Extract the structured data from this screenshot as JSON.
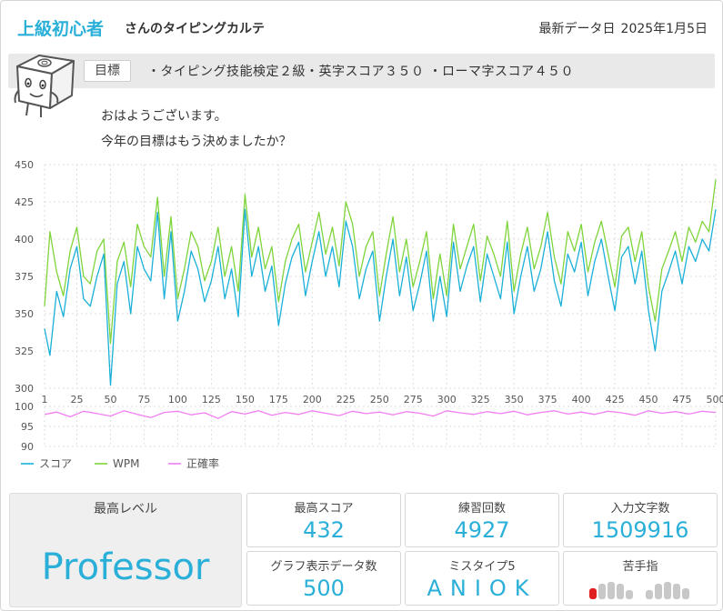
{
  "header": {
    "user_name": "上級初心者",
    "user_suffix": "さんのタイピングカルテ",
    "latest_label": "最新データ日",
    "latest_date": "2025年1月5日"
  },
  "goal": {
    "label": "目標",
    "text": "・タイピング技能検定２級・英字スコア３５０ ・ローマ字スコア４５０"
  },
  "greeting": {
    "line1": "おはようございます。",
    "line2": "今年の目標はもう決めましたか？"
  },
  "colors": {
    "score": "#1ab0d8",
    "wpm": "#7fd43a",
    "accuracy": "#f17ff1",
    "accent": "#2ab0d8",
    "weak_finger": "#e02020",
    "finger": "#c8c8c8"
  },
  "chart_data": {
    "type": "line",
    "x_ticks": [
      1,
      25,
      50,
      75,
      100,
      125,
      150,
      175,
      200,
      225,
      250,
      275,
      300,
      325,
      350,
      375,
      400,
      425,
      450,
      475,
      500
    ],
    "x_range": [
      1,
      500
    ],
    "upper": {
      "ylim": [
        300,
        450
      ],
      "yticks": [
        300,
        325,
        350,
        375,
        400,
        425,
        450
      ],
      "grid": true
    },
    "lower": {
      "ylim": [
        90,
        100
      ],
      "yticks": [
        90,
        95,
        100
      ],
      "grid": true
    },
    "series": [
      {
        "name": "スコア",
        "panel": "upper",
        "x": [
          1,
          5,
          10,
          15,
          20,
          25,
          30,
          35,
          40,
          45,
          50,
          55,
          60,
          65,
          70,
          75,
          80,
          85,
          90,
          95,
          100,
          105,
          110,
          115,
          120,
          125,
          130,
          135,
          140,
          145,
          150,
          155,
          160,
          165,
          170,
          175,
          180,
          185,
          190,
          195,
          200,
          205,
          210,
          215,
          220,
          225,
          230,
          235,
          240,
          245,
          250,
          255,
          260,
          265,
          270,
          275,
          280,
          285,
          290,
          295,
          300,
          305,
          310,
          315,
          320,
          325,
          330,
          335,
          340,
          345,
          350,
          355,
          360,
          365,
          370,
          375,
          380,
          385,
          390,
          395,
          400,
          405,
          410,
          415,
          420,
          425,
          430,
          435,
          440,
          445,
          450,
          455,
          460,
          465,
          470,
          475,
          480,
          485,
          490,
          495,
          500
        ],
        "values": [
          340,
          322,
          365,
          348,
          380,
          395,
          360,
          355,
          375,
          390,
          302,
          370,
          385,
          350,
          395,
          380,
          372,
          418,
          360,
          405,
          345,
          365,
          392,
          380,
          358,
          372,
          395,
          360,
          380,
          348,
          420,
          375,
          395,
          365,
          382,
          342,
          370,
          388,
          398,
          362,
          385,
          405,
          375,
          395,
          368,
          412,
          395,
          360,
          380,
          392,
          345,
          375,
          400,
          362,
          388,
          352,
          370,
          392,
          345,
          375,
          348,
          398,
          365,
          382,
          395,
          358,
          390,
          375,
          360,
          398,
          350,
          375,
          395,
          365,
          380,
          405,
          372,
          355,
          390,
          378,
          398,
          362,
          385,
          400,
          375,
          352,
          388,
          395,
          370,
          392,
          352,
          325,
          365,
          378,
          392,
          370,
          395,
          385,
          400,
          392,
          420
        ]
      },
      {
        "name": "WPM",
        "panel": "upper",
        "x": [
          1,
          5,
          10,
          15,
          20,
          25,
          30,
          35,
          40,
          45,
          50,
          55,
          60,
          65,
          70,
          75,
          80,
          85,
          90,
          95,
          100,
          105,
          110,
          115,
          120,
          125,
          130,
          135,
          140,
          145,
          150,
          155,
          160,
          165,
          170,
          175,
          180,
          185,
          190,
          195,
          200,
          205,
          210,
          215,
          220,
          225,
          230,
          235,
          240,
          245,
          250,
          255,
          260,
          265,
          270,
          275,
          280,
          285,
          290,
          295,
          300,
          305,
          310,
          315,
          320,
          325,
          330,
          335,
          340,
          345,
          350,
          355,
          360,
          365,
          370,
          375,
          380,
          385,
          390,
          395,
          400,
          405,
          410,
          415,
          420,
          425,
          430,
          435,
          440,
          445,
          450,
          455,
          460,
          465,
          470,
          475,
          480,
          485,
          490,
          495,
          500
        ],
        "values": [
          355,
          405,
          378,
          362,
          392,
          408,
          375,
          370,
          392,
          400,
          330,
          385,
          398,
          368,
          410,
          395,
          388,
          428,
          375,
          415,
          360,
          380,
          405,
          395,
          372,
          385,
          408,
          375,
          395,
          365,
          430,
          388,
          408,
          380,
          395,
          358,
          385,
          400,
          410,
          378,
          398,
          418,
          390,
          408,
          382,
          425,
          410,
          375,
          395,
          405,
          362,
          390,
          415,
          378,
          400,
          368,
          385,
          405,
          360,
          390,
          362,
          410,
          380,
          395,
          410,
          372,
          402,
          390,
          375,
          412,
          365,
          390,
          408,
          380,
          395,
          418,
          388,
          370,
          405,
          392,
          410,
          378,
          398,
          412,
          390,
          368,
          402,
          408,
          385,
          405,
          368,
          345,
          380,
          392,
          405,
          385,
          408,
          398,
          412,
          405,
          440
        ]
      },
      {
        "name": "正確率",
        "panel": "lower",
        "x": [
          1,
          10,
          20,
          30,
          40,
          50,
          60,
          70,
          80,
          90,
          100,
          110,
          120,
          130,
          140,
          150,
          160,
          170,
          180,
          190,
          200,
          210,
          220,
          230,
          240,
          250,
          260,
          270,
          280,
          290,
          300,
          310,
          320,
          330,
          340,
          350,
          360,
          370,
          380,
          390,
          400,
          410,
          420,
          430,
          440,
          450,
          460,
          470,
          480,
          490,
          500
        ],
        "values": [
          98.0,
          98.6,
          97.4,
          98.8,
          98.2,
          97.6,
          98.9,
          98.0,
          97.2,
          98.5,
          98.8,
          97.9,
          98.4,
          97.0,
          98.7,
          98.1,
          98.9,
          97.8,
          98.5,
          98.0,
          98.9,
          98.3,
          97.7,
          98.8,
          98.2,
          98.6,
          97.9,
          98.7,
          98.3,
          97.6,
          98.9,
          98.4,
          98.0,
          98.7,
          98.2,
          98.8,
          97.9,
          98.5,
          98.9,
          98.1,
          98.6,
          98.0,
          98.8,
          98.4,
          97.8,
          98.9,
          98.3,
          98.7,
          98.1,
          98.8,
          98.5
        ]
      }
    ],
    "legend": {
      "placement": "bottom-left"
    }
  },
  "stats": {
    "level_title": "最高レベル",
    "level_value": "Professor",
    "max_score_title": "最高スコア",
    "max_score_value": "432",
    "practice_title": "練習回数",
    "practice_value": "4927",
    "chars_title": "入力文字数",
    "chars_value": "1509916",
    "graph_points_title": "グラフ表示データ数",
    "graph_points_value": "500",
    "mistype_title": "ミスタイプ5",
    "mistype_value": "ANIOK",
    "weak_finger_title": "苦手指",
    "weak_finger_index": 0
  }
}
